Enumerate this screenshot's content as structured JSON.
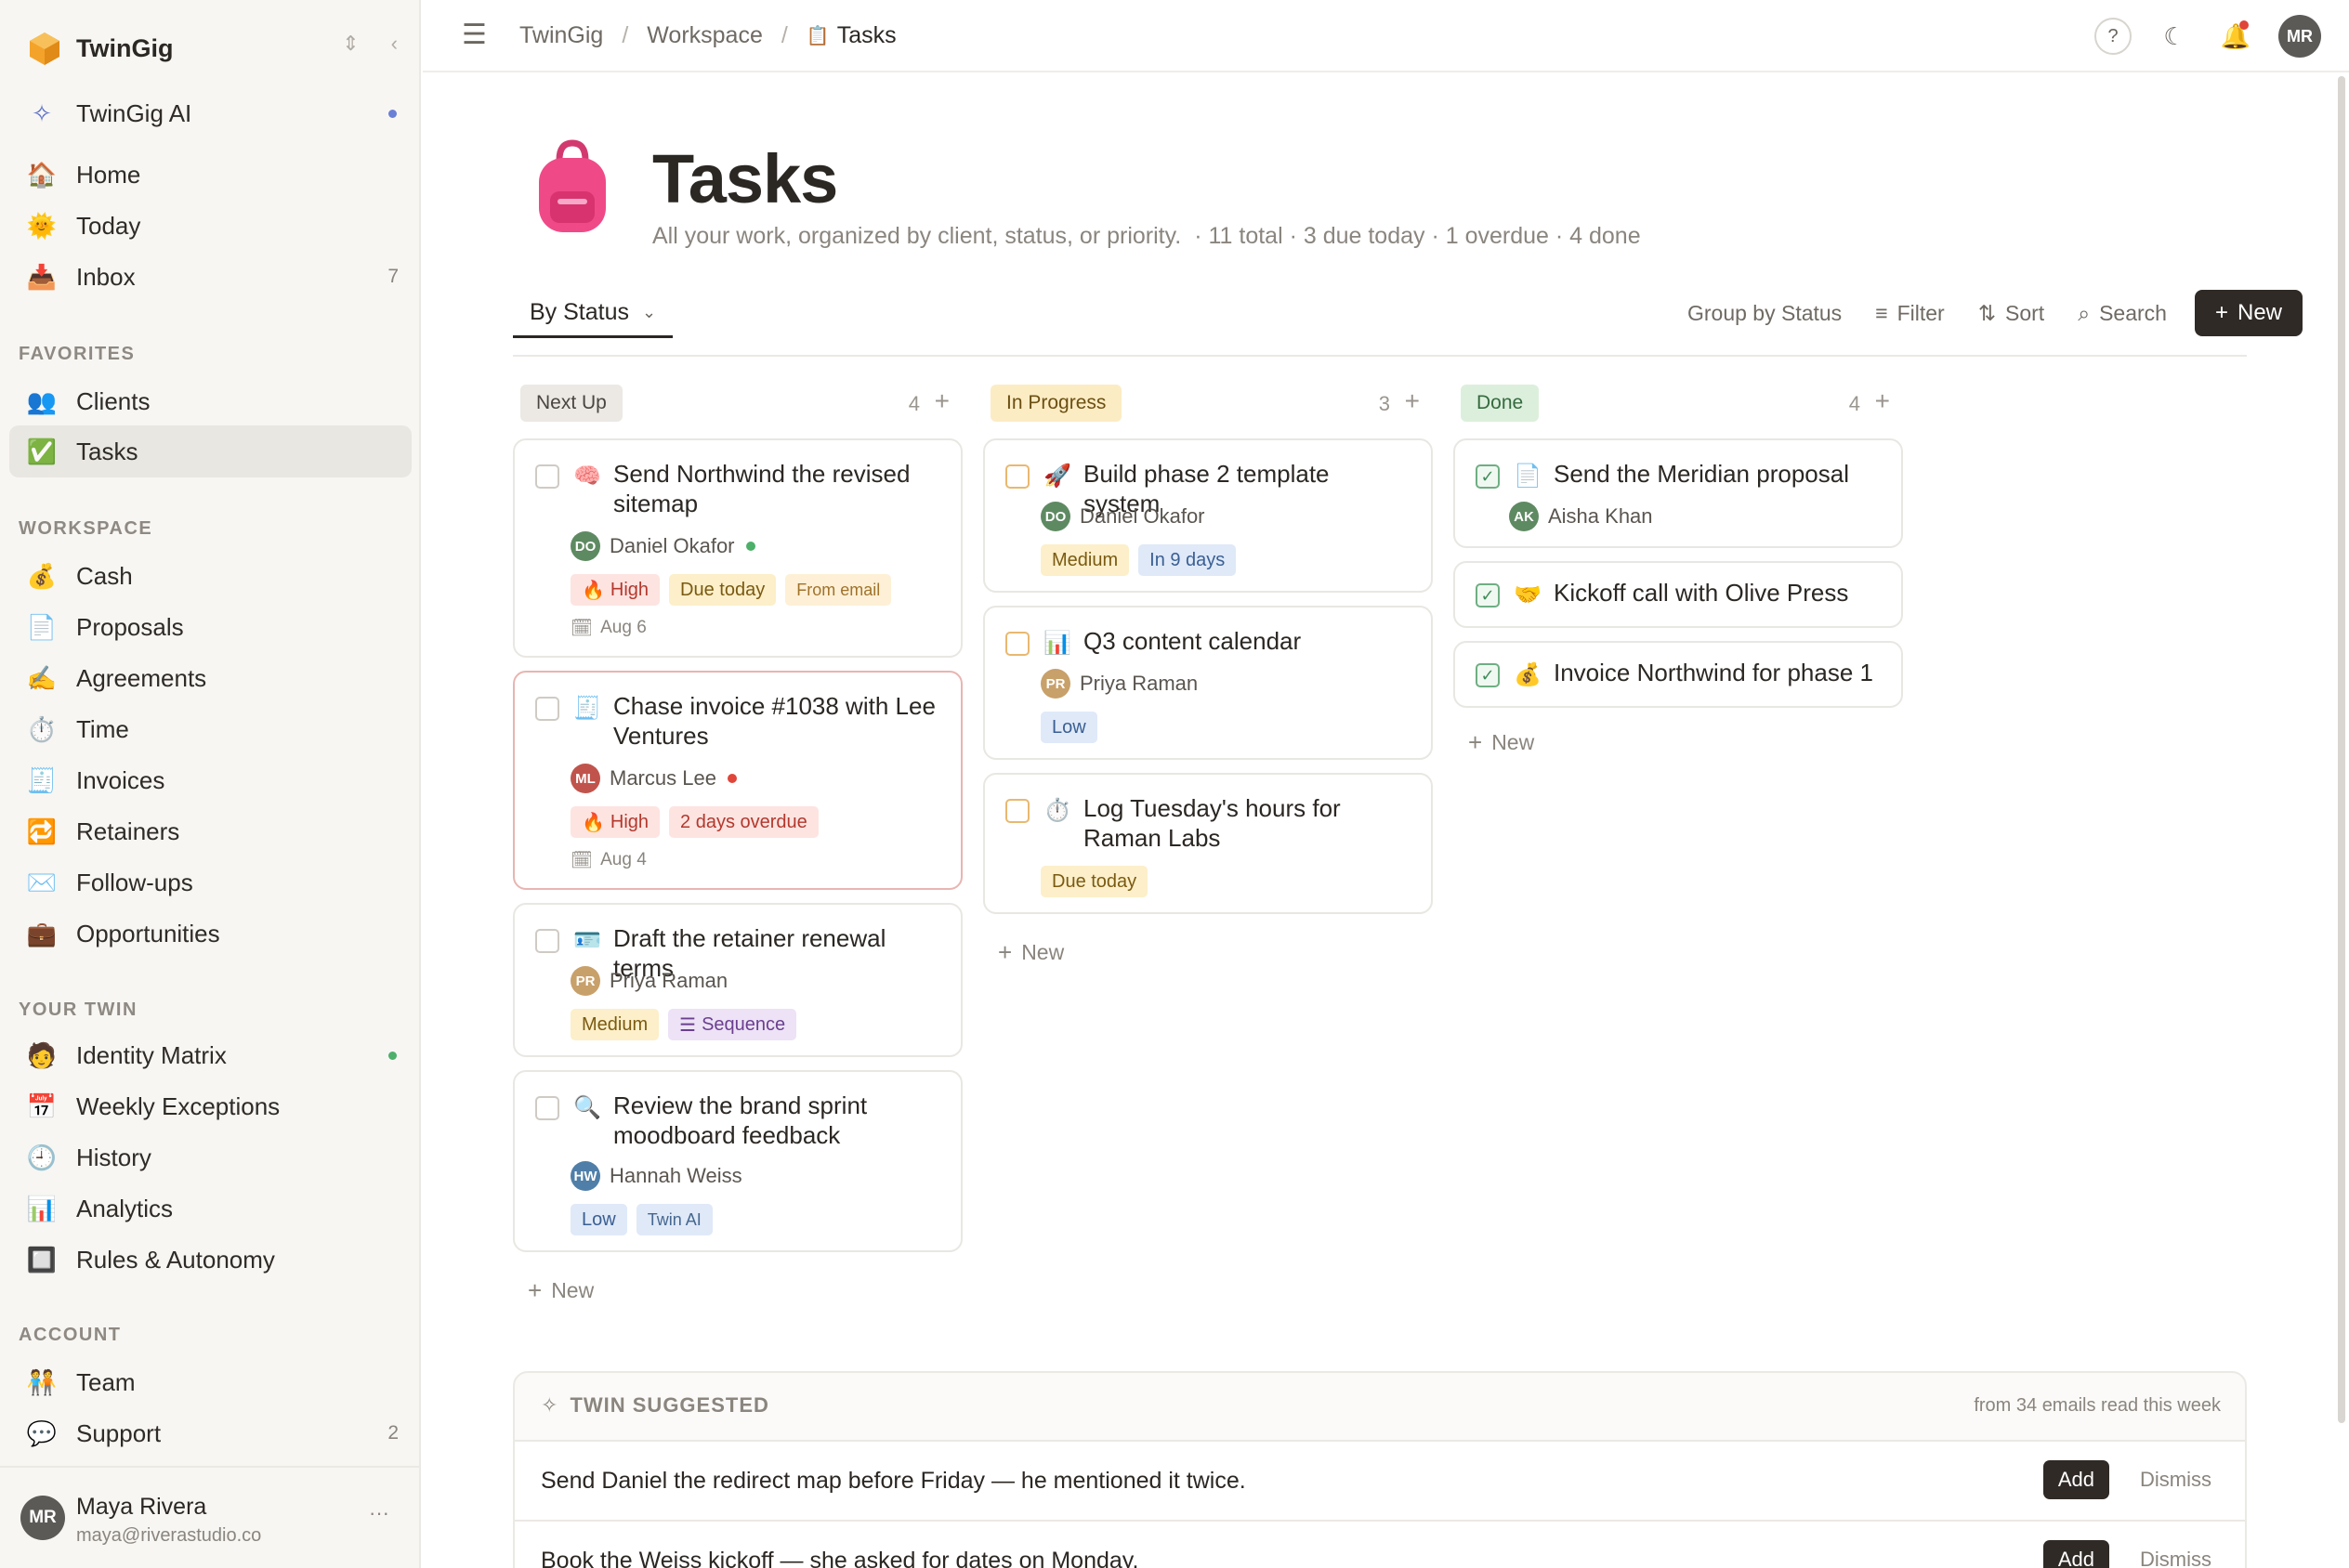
{
  "app": {
    "name": "TwinGig"
  },
  "sidebar": {
    "ai_item": {
      "label": "TwinGig AI",
      "dot_color": "#6a7fd6"
    },
    "main_items": [
      {
        "label": "Home",
        "icon": "house-icon"
      },
      {
        "label": "Today",
        "icon": "sun-icon"
      },
      {
        "label": "Inbox",
        "icon": "inbox-icon",
        "count": "7"
      }
    ],
    "favorites_label": "FAVORITES",
    "favorites": [
      {
        "label": "Clients",
        "icon": "people-icon"
      },
      {
        "label": "Tasks",
        "icon": "checkbox-icon",
        "active": true
      }
    ],
    "workspace_label": "WORKSPACE",
    "workspace": [
      {
        "label": "Cash",
        "icon": "money-bag-icon"
      },
      {
        "label": "Proposals",
        "icon": "document-icon"
      },
      {
        "label": "Agreements",
        "icon": "signing-icon"
      },
      {
        "label": "Time",
        "icon": "stopwatch-icon"
      },
      {
        "label": "Invoices",
        "icon": "receipt-icon"
      },
      {
        "label": "Retainers",
        "icon": "repeat-icon"
      },
      {
        "label": "Follow-ups",
        "icon": "envelope-icon"
      },
      {
        "label": "Opportunities",
        "icon": "briefcase-icon"
      }
    ],
    "twin_label": "YOUR TWIN",
    "twin": [
      {
        "label": "Identity Matrix",
        "icon": "identity-icon",
        "dot_color": "#4caf6a"
      },
      {
        "label": "Weekly Exceptions",
        "icon": "calendar-icon"
      },
      {
        "label": "History",
        "icon": "clock-icon"
      },
      {
        "label": "Analytics",
        "icon": "bar-chart-icon"
      },
      {
        "label": "Rules & Autonomy",
        "icon": "grid-icon"
      }
    ],
    "account_label": "ACCOUNT",
    "account": [
      {
        "label": "Team",
        "icon": "team-icon"
      },
      {
        "label": "Support",
        "icon": "speech-bubble-icon",
        "count": "2"
      }
    ],
    "user": {
      "initials": "MR",
      "name": "Maya Rivera",
      "email": "maya@riverastudio.co"
    }
  },
  "topbar": {
    "crumbs": [
      "TwinGig",
      "Workspace",
      "Tasks"
    ],
    "avatar": "MR"
  },
  "page": {
    "title": "Tasks",
    "subtitle": "All your work, organized by client, status, or priority.",
    "meta": "· 11 total · 3 due today · 1 overdue · 4 done"
  },
  "toolbar": {
    "view": "By Status",
    "group": "Group by Status",
    "filter": "Filter",
    "sort": "Sort",
    "search": "Search",
    "new": "New"
  },
  "columns": [
    {
      "label": "Next Up",
      "count": "4",
      "new_label": "New",
      "cards": [
        {
          "title": "Send Northwind the revised sitemap",
          "icon": "brain-icon",
          "person": {
            "initials": "DO",
            "name": "Daniel Okafor",
            "color": "#5e8a62",
            "dot": "#4caf6a"
          },
          "tags": [
            {
              "text": "High",
              "kind": "red",
              "fire": true
            },
            {
              "text": "Due today",
              "kind": "yel"
            },
            {
              "text": "From email",
              "kind": "email"
            }
          ],
          "date": "Aug 6"
        },
        {
          "title": "Chase invoice #1038 with Lee Ventures",
          "icon": "receipt-icon",
          "alert": true,
          "person": {
            "initials": "ML",
            "name": "Marcus Lee",
            "color": "#c0544c",
            "dot": "#e0453a"
          },
          "tags": [
            {
              "text": "High",
              "kind": "red",
              "fire": true
            },
            {
              "text": "2 days overdue",
              "kind": "red"
            }
          ],
          "date": "Aug 4"
        },
        {
          "title": "Draft the retainer renewal terms",
          "icon": "id-card-icon",
          "person": {
            "initials": "PR",
            "name": "Priya Raman",
            "color": "#c8a06a"
          },
          "tags": [
            {
              "text": "Medium",
              "kind": "yel"
            },
            {
              "text": "Sequence",
              "kind": "purp",
              "list": true
            }
          ]
        },
        {
          "title": "Review the brand sprint moodboard feedback",
          "icon": "magnifier-icon",
          "person": {
            "initials": "HW",
            "name": "Hannah Weiss",
            "color": "#4f7fa8"
          },
          "tags": [
            {
              "text": "Low",
              "kind": "blue"
            },
            {
              "text": "Twin AI",
              "kind": "twin"
            }
          ]
        }
      ]
    },
    {
      "label": "In Progress",
      "count": "3",
      "new_label": "New",
      "cards": [
        {
          "title": "Build phase 2 template system",
          "icon": "rocket-icon",
          "person": {
            "initials": "DO",
            "name": "Daniel Okafor",
            "color": "#5e8a62"
          },
          "tags": [
            {
              "text": "Medium",
              "kind": "yel"
            },
            {
              "text": "In 9 days",
              "kind": "blue"
            }
          ]
        },
        {
          "title": "Q3 content calendar",
          "icon": "bar-chart-icon",
          "person": {
            "initials": "PR",
            "name": "Priya Raman",
            "color": "#c8a06a"
          },
          "tags": [
            {
              "text": "Low",
              "kind": "blue"
            }
          ]
        },
        {
          "title": "Log Tuesday's hours for Raman Labs",
          "icon": "stopwatch-icon",
          "tags": [
            {
              "text": "Due today",
              "kind": "yel"
            }
          ]
        }
      ]
    },
    {
      "label": "Done",
      "count": "4",
      "new_label": "New",
      "cards": [
        {
          "title": "Send the Meridian proposal",
          "icon": "document-icon",
          "person": {
            "initials": "AK",
            "name": "Aisha Khan",
            "color": "#5e8a62"
          }
        },
        {
          "title": "Kickoff call with Olive Press",
          "icon": "handshake-icon"
        },
        {
          "title": "Invoice Northwind for phase 1",
          "icon": "money-bag-icon"
        }
      ]
    }
  ],
  "twin_suggested": {
    "title": "TWIN SUGGESTED",
    "source": "from 34 emails read this week",
    "add": "Add",
    "dismiss": "Dismiss",
    "rows": [
      "Send Daniel the redirect map before Friday — he mentioned it twice.",
      "Book the Weiss kickoff — she asked for dates on Monday."
    ]
  },
  "colors": {
    "accent": "#2f2a26",
    "next_up": "#ece9e4",
    "in_progress": "#fcecc4",
    "done": "#dcefdc"
  }
}
